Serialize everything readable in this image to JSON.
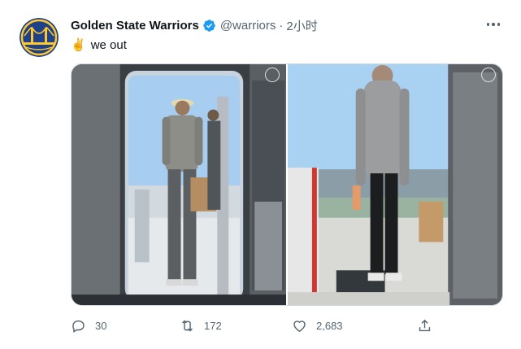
{
  "tweet": {
    "display_name": "Golden State Warriors",
    "handle": "@warriors",
    "separator": "·",
    "time": "2小时",
    "emoji": "✌",
    "text": "we out"
  },
  "actions": {
    "replies": "30",
    "retweets": "172",
    "likes": "2,683"
  },
  "colors": {
    "verified": "#1d9bf0",
    "secondary_text": "#536471",
    "warriors_blue": "#1d428a",
    "warriors_gold": "#ffc72c"
  },
  "icons": {
    "avatar": "warriors-logo",
    "verified": "verified-badge-icon",
    "more": "more-icon",
    "reply": "reply-icon",
    "retweet": "retweet-icon",
    "like": "heart-icon",
    "share": "share-icon"
  }
}
